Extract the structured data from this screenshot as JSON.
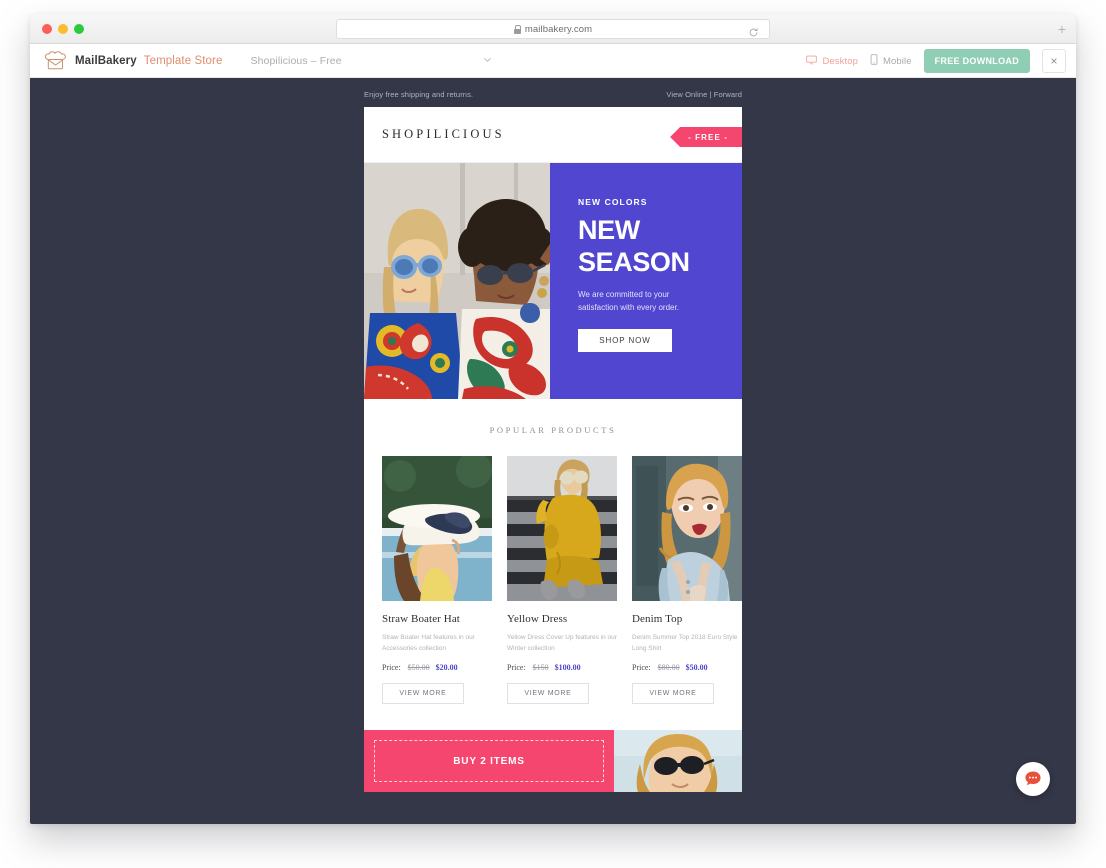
{
  "browser": {
    "url": "mailbakery.com",
    "lock_icon": "lock-icon",
    "reload_icon": "reload-icon",
    "new_tab_label": "+",
    "traffic_lights": [
      "close",
      "minimize",
      "zoom"
    ]
  },
  "appbar": {
    "logo_icon": "mailbakery-hat-icon",
    "brand_name": "MailBakery",
    "brand_sub": "Template Store",
    "template_name": "Shopilicious – Free",
    "dropdown_icon": "chevron-down-icon",
    "views": [
      {
        "label": "Desktop",
        "icon": "desktop-monitor-icon",
        "active": true
      },
      {
        "label": "Mobile",
        "icon": "mobile-phone-icon",
        "active": false
      }
    ],
    "download_label": "FREE DOWNLOAD",
    "close_label": "×",
    "accent_pink": "#f2a09a",
    "accent_green": "#8fcdb5",
    "brand_orange": "#e08d6d"
  },
  "email": {
    "preheader": {
      "left": "Enjoy free shipping and returns.",
      "right": "View Online | Forward"
    },
    "header": {
      "logo": "SHOPILICIOUS",
      "ribbon": "- FREE -",
      "ribbon_color": "#f4466f"
    },
    "hero": {
      "kicker": "NEW COLORS",
      "title_line1": "NEW",
      "title_line2": "SEASON",
      "subtitle": "We are committed to your satisfaction with every order.",
      "button": "SHOP NOW",
      "panel_color": "#5146d0",
      "image_alt": "two women in colorful paisley jackets wearing sunglasses"
    },
    "products_section": {
      "title": "POPULAR PRODUCTS",
      "items": [
        {
          "name": "Straw Boater Hat",
          "desc": "Straw Boater Hat features in our Accessories collection",
          "price_label": "Price:",
          "price_old": "$50.00",
          "price_new": "$20.00",
          "button": "VIEW MORE",
          "image_alt": "woman wearing white straw hat with navy bow by a pool"
        },
        {
          "name": "Yellow Dress",
          "desc": "Yellow Dress Cover Up features in our Winter collection",
          "price_label": "Price:",
          "price_old": "$150",
          "price_new": "$100.00",
          "button": "VIEW MORE",
          "image_alt": "woman in yellow dress sitting on steps with sunglasses"
        },
        {
          "name": "Denim Top",
          "desc": "Denim Summer Top 2018 Euro Style Long Shirt",
          "price_label": "Price:",
          "price_old": "$80.00",
          "price_new": "$50.00",
          "button": "VIEW MORE",
          "image_alt": "blonde woman in light denim jacket with red lipstick"
        }
      ],
      "sale_color": "#4b45c9"
    },
    "promo": {
      "text": "BUY 2 ITEMS",
      "background": "#f4466f",
      "image_alt": "woman with sunglasses and blonde hair"
    },
    "canvas_background": "#343748"
  },
  "chat_widget": {
    "icon": "chat-bubble-icon",
    "color": "#e8503a"
  }
}
